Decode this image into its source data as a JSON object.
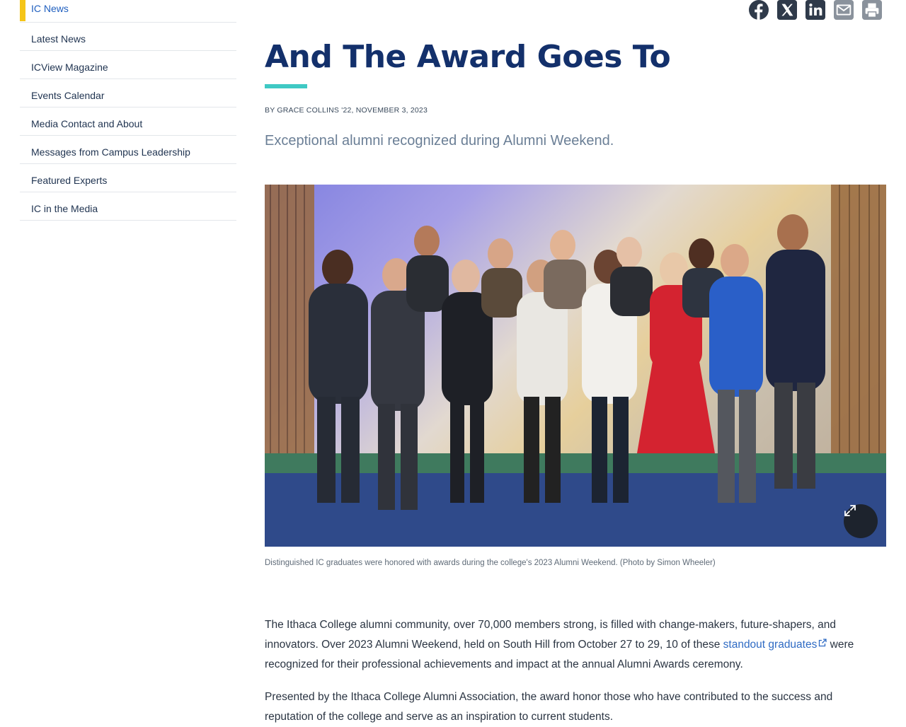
{
  "sidebar": {
    "items": [
      {
        "label": "IC News",
        "active": true
      },
      {
        "label": "Latest News"
      },
      {
        "label": "ICView Magazine"
      },
      {
        "label": "Events Calendar"
      },
      {
        "label": "Media Contact and About"
      },
      {
        "label": "Messages from Campus Leadership"
      },
      {
        "label": "Featured Experts"
      },
      {
        "label": "IC in the Media"
      }
    ]
  },
  "share": {
    "icons": [
      "facebook-icon",
      "x-icon",
      "linkedin-icon",
      "email-icon",
      "print-icon"
    ]
  },
  "article": {
    "title": "And The Award Goes To",
    "byline": "BY GRACE COLLINS '22, NOVEMBER 3, 2023",
    "dek": "Exceptional alumni recognized during Alumni Weekend.",
    "caption": "Distinguished IC graduates were honored with awards during the college's 2023 Alumni Weekend. (Photo by Simon Wheeler)",
    "p1_before": "The Ithaca College alumni community, over 70,000 members strong, is filled with change-makers, future-shapers, and innovators. Over 2023 Alumni Weekend, held on South Hill from October 27 to 29, 10 of these ",
    "p1_link": "standout graduates",
    "p1_after": " were recognized for their professional achievements and impact at the annual Alumni Awards ceremony.",
    "p2": "Presented by the Ithaca College Alumni Association, the award honor those who have contributed to the success and reputation of the college and serve as an inspiration to current students."
  },
  "colors": {
    "title": "#13306b",
    "accent_rule": "#3fc9c4",
    "active_marker": "#f5c518",
    "link": "#2f6bc4",
    "share_icons": "#2f3a4a"
  }
}
